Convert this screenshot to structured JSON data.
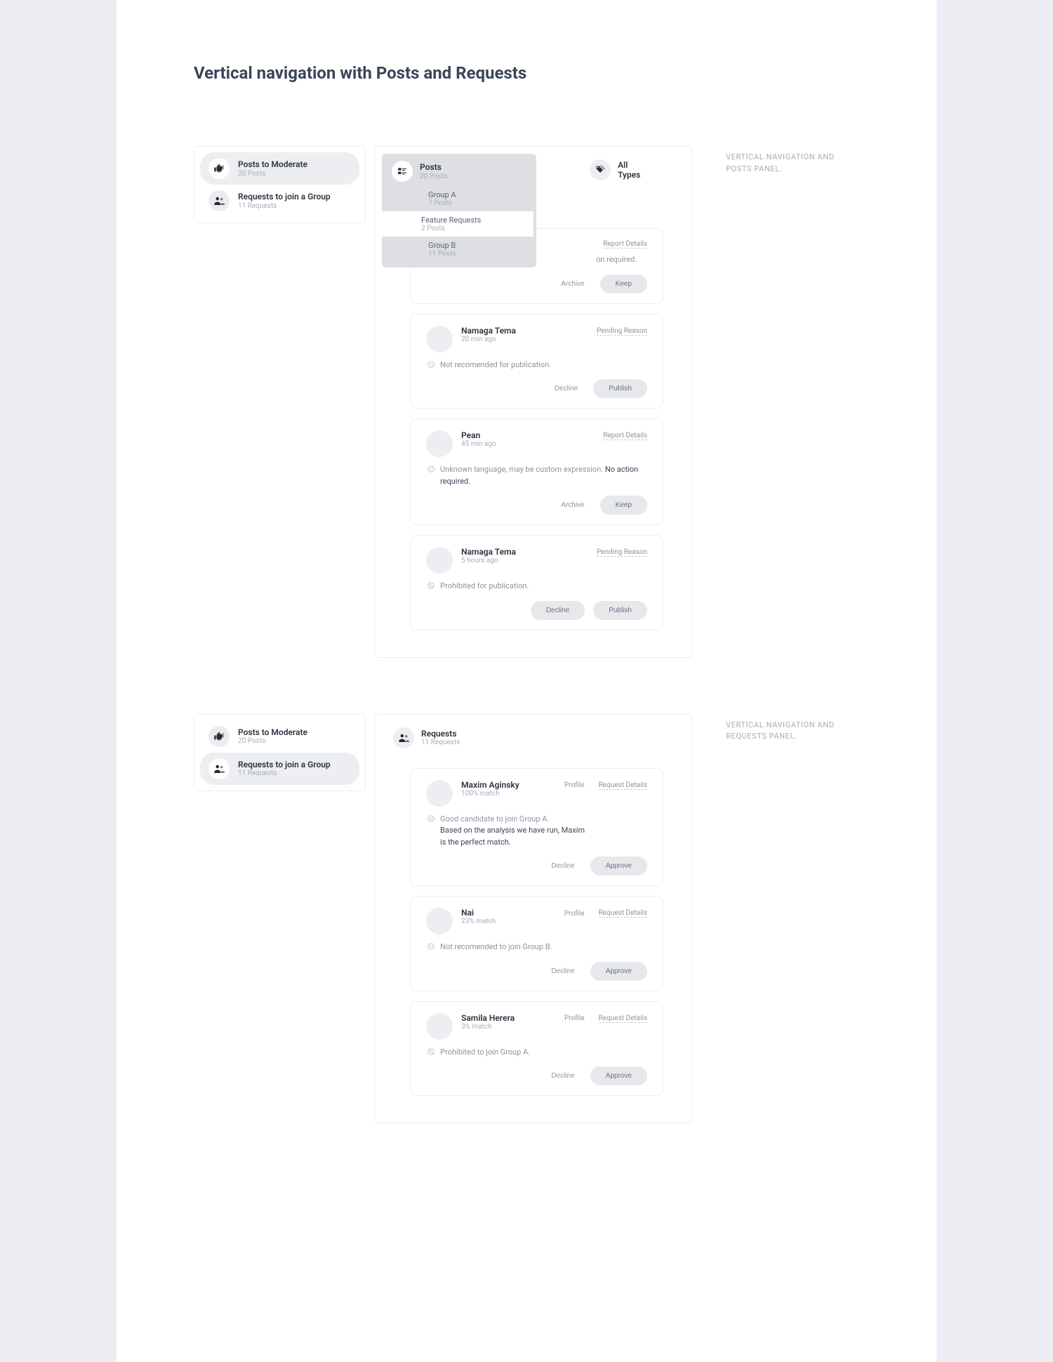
{
  "page": {
    "title": "Vertical navigation with Posts and Requests"
  },
  "captions": {
    "posts": "VERTICAL NAVIGATION AND POSTS PANEL.",
    "requests": "VERTICAL NAVIGATION AND REQUESTS PANEL."
  },
  "sidebar": {
    "posts": {
      "label": "Posts to Moderate",
      "sub": "20 Posts"
    },
    "requests": {
      "label": "Requests to join a Group",
      "sub": "11 Requests"
    }
  },
  "posts_panel": {
    "header": {
      "label": "Posts",
      "sub": "20 Posts"
    },
    "groups": [
      {
        "label": "Group A",
        "sub": "7 Posts"
      },
      {
        "label": "Feature Requests",
        "sub": "2 Posts"
      },
      {
        "label": "Group B",
        "sub": "11 Posts"
      }
    ],
    "types": "All Types",
    "cards": [
      {
        "title": "",
        "meta": "",
        "link": "Report Details",
        "body": "on required.",
        "actions": {
          "secondary": "Archive",
          "primary": "Keep"
        }
      },
      {
        "title": "Namaga Tema",
        "meta": "20 min ago",
        "link": "Pending Reason",
        "body": "Not recomended for publication.",
        "actions": {
          "secondary": "Decline",
          "primary": "Publish"
        }
      },
      {
        "title": "Pean",
        "meta": "45 min ago",
        "link": "Report Details",
        "body": "Unknown language, may be custom expression.",
        "body_strong": "No action required.",
        "actions": {
          "secondary": "Archive",
          "primary": "Keep"
        }
      },
      {
        "title": "Namaga Tema",
        "meta": "5 hours ago",
        "link": "Pending Reason",
        "body": "Prohibited for publication.",
        "actions": {
          "secondary": "Decline",
          "primary": "Publish"
        }
      }
    ]
  },
  "requests_panel": {
    "header": {
      "label": "Requests",
      "sub": "11 Requests"
    },
    "cards": [
      {
        "title": "Maxim Aginsky",
        "meta": "100% match",
        "link1": "Profile",
        "link2": "Request Details",
        "body": "Good candidate to join Group A.",
        "body2": "Based on the analysis we have run, Maxim is the perfect match.",
        "actions": {
          "secondary": "Decline",
          "primary": "Approve"
        }
      },
      {
        "title": "Nai",
        "meta": "23% match",
        "link1": "Profile",
        "link2": "Request Details",
        "body": "Not recomended to join Group B.",
        "actions": {
          "secondary": "Decline",
          "primary": "Approve"
        }
      },
      {
        "title": "Samila Herera",
        "meta": "3% match",
        "link1": "Profile",
        "link2": "Request Details",
        "body": "Prohibited to join Group A.",
        "actions": {
          "secondary": "Decline",
          "primary": "Approve"
        }
      }
    ]
  }
}
